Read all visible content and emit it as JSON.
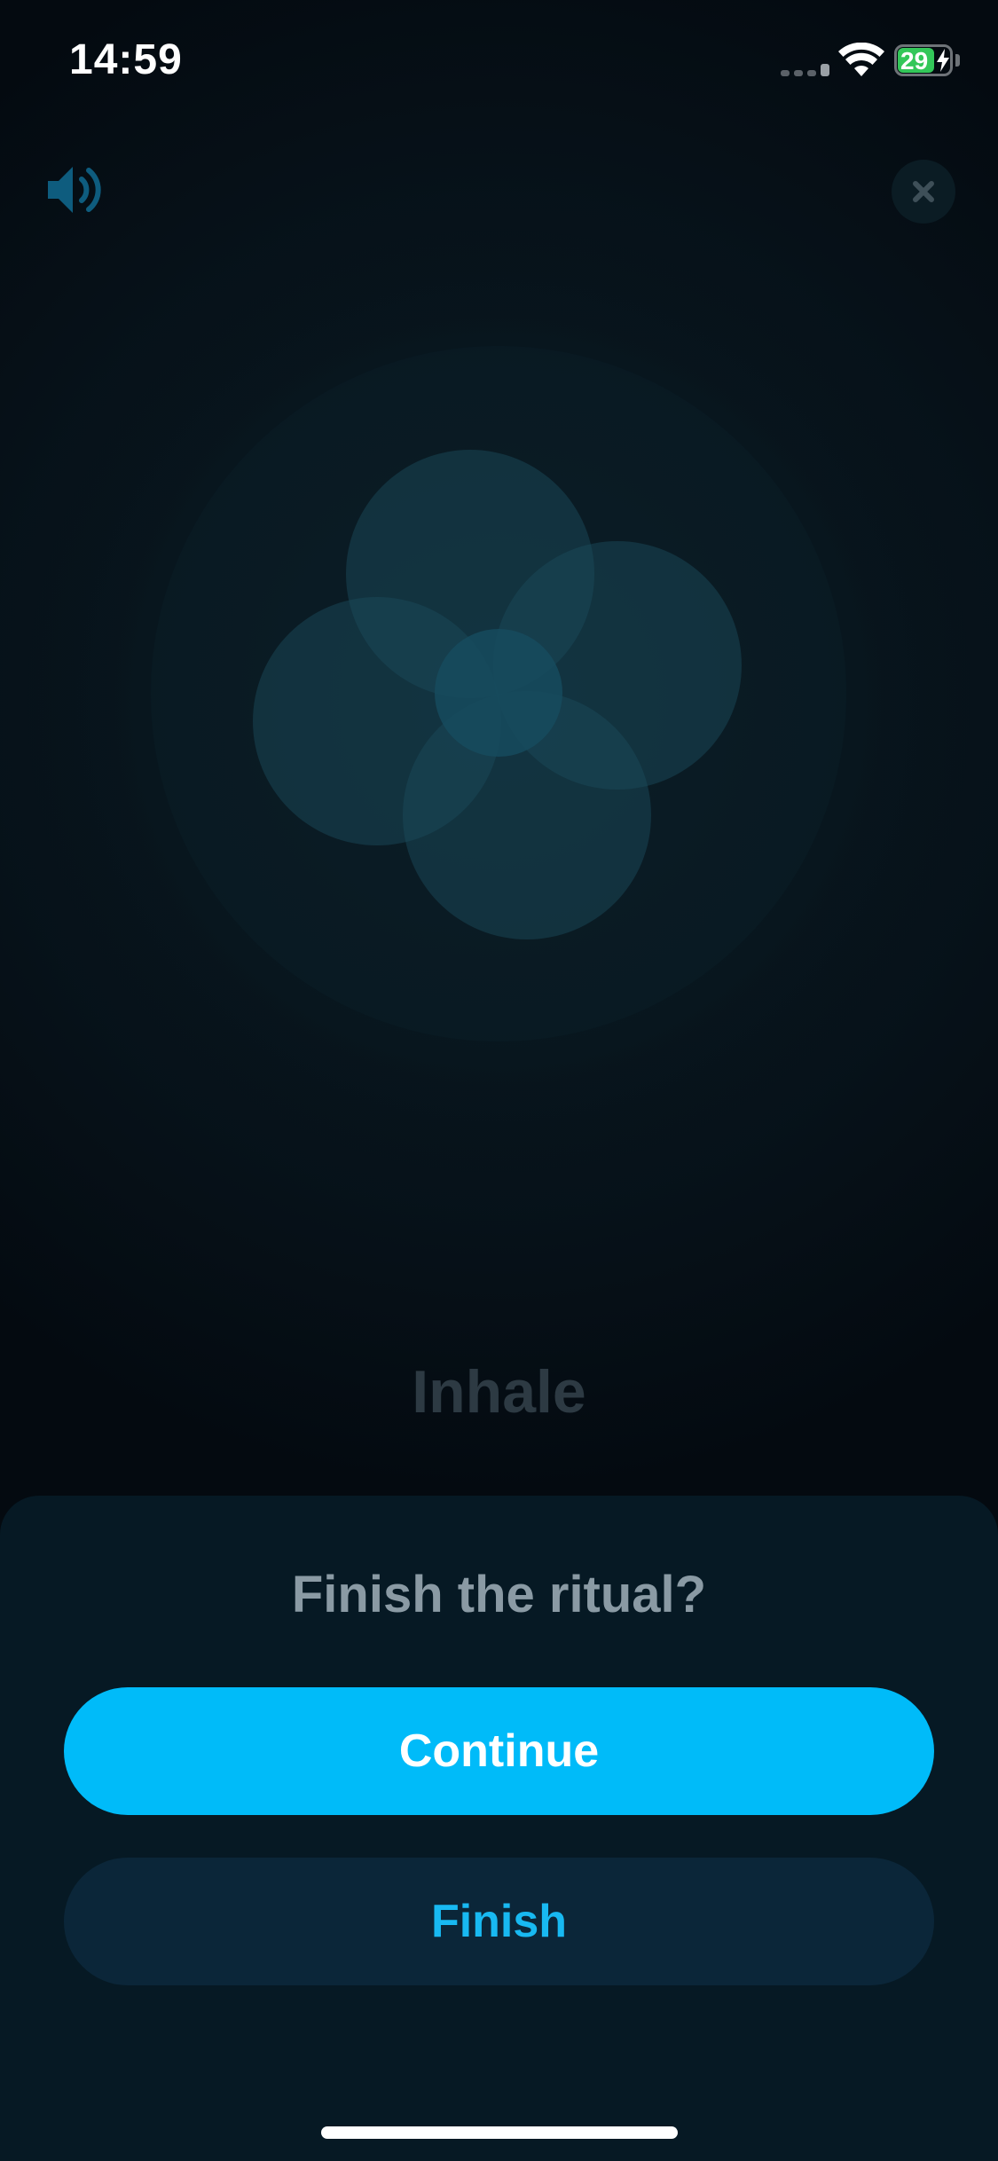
{
  "status_bar": {
    "time": "14:59",
    "battery_level": "29",
    "battery_fraction": 0.29,
    "charging": true
  },
  "controls": {
    "sound_icon": "speaker-icon",
    "close_icon": "close-icon"
  },
  "breathing": {
    "phase_label": "Inhale"
  },
  "dialog": {
    "title": "Finish the ritual?",
    "continue_label": "Continue",
    "finish_label": "Finish"
  },
  "colors": {
    "accent": "#00bbf9",
    "secondary_button": "#0b2639",
    "sheet_background": "#061924",
    "petal": "#1a4a5a"
  }
}
